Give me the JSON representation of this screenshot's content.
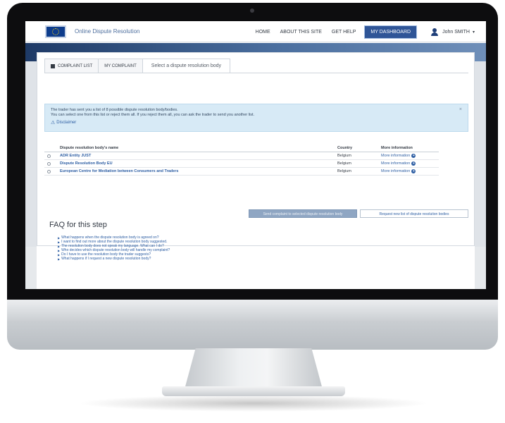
{
  "header": {
    "site_title": "Online Dispute Resolution",
    "nav": {
      "home": "HOME",
      "about": "ABOUT THIS SITE",
      "help": "GET HELP",
      "dashboard": "MY DASHBOARD"
    },
    "user_name": "John SMITH",
    "user_caret": "▾"
  },
  "tabs": {
    "complaint_list": "COMPLAINT LIST",
    "my_complaint": "MY COMPLAINT",
    "current_step": "Select a dispute resolution body"
  },
  "info_box": {
    "line1": "The trader has sent you a list of 8 possible dispute resolution body/bodies.",
    "line2": "You can select one from this list or reject them all. If you reject them all, you can ask the trader to send you another list.",
    "disclaimer": "Disclaimer",
    "close": "×"
  },
  "table": {
    "headers": {
      "name": "Dispute resolution body's name",
      "country": "Country",
      "more": "More information"
    },
    "rows": [
      {
        "name": "ADR Entity JUST",
        "country": "Belgium",
        "more": "More information"
      },
      {
        "name": "Dispute Resolution Body EU",
        "country": "Belgium",
        "more": "More information"
      },
      {
        "name": "European Centre for Mediation between Consumers and Traders",
        "country": "Belgium",
        "more": "More information"
      }
    ]
  },
  "buttons": {
    "send": "Send complaint to selected dispute resolution body",
    "request": "Request new list of dispute resolution bodies"
  },
  "faq": {
    "title": "FAQ for this step",
    "items": [
      "What happens when the dispute resolution body is agreed on?",
      "I want to find out more about the dispute resolution body suggested.",
      "The resolution body does not speak my language. What can I do?",
      "Who decides which dispute resolution body will handle my complaint?",
      "Do I have to use the resolution body the trader suggests?",
      "What happens if I request a new dispute resolution body?"
    ]
  },
  "colors": {
    "accent": "#2f5597",
    "link": "#2d5ea3",
    "info_bg": "#d7eaf6",
    "send_button_disabled": "#8fa6c3"
  }
}
